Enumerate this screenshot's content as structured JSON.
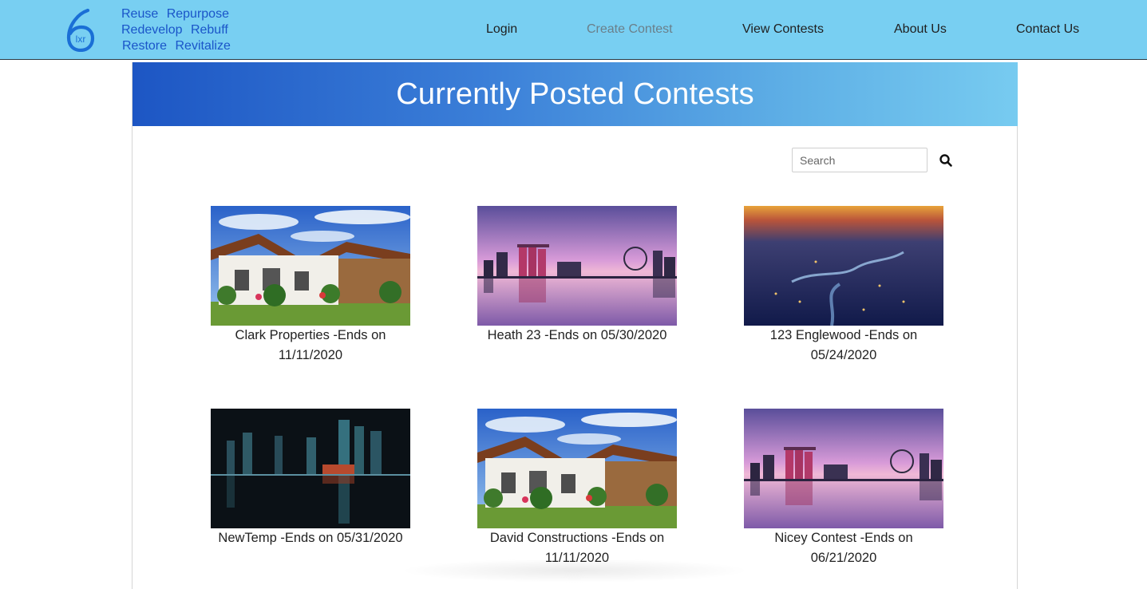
{
  "brand": {
    "logo_text": "lxr",
    "tagline": [
      [
        "Reuse",
        "Repurpose"
      ],
      [
        "Redevelop",
        "Rebuff"
      ],
      [
        "Restore",
        "Revitalize"
      ]
    ]
  },
  "nav": {
    "login": "Login",
    "create_contest": "Create Contest",
    "view_contests": "View Contests",
    "about_us": "About Us",
    "contact_us": "Contact Us"
  },
  "page": {
    "title": "Currently Posted Contests"
  },
  "search": {
    "placeholder": "Search"
  },
  "contests": [
    {
      "caption": "Clark Properties -Ends on 11/11/2020",
      "image": "house"
    },
    {
      "caption": "Heath 23 -Ends on 05/30/2020",
      "image": "skyline-sunset"
    },
    {
      "caption": "123 Englewood -Ends on 05/24/2020",
      "image": "aerial-city"
    },
    {
      "caption": "NewTemp -Ends on 05/31/2020",
      "image": "night-skyline"
    },
    {
      "caption": "David Constructions -Ends on 11/11/2020",
      "image": "house"
    },
    {
      "caption": "Nicey Contest -Ends on 06/21/2020",
      "image": "skyline-sunset"
    }
  ],
  "colors": {
    "navbar": "#78cff2",
    "brand_blue": "#1a55c9",
    "banner_start": "#1d56c4",
    "banner_end": "#77cbf0"
  }
}
